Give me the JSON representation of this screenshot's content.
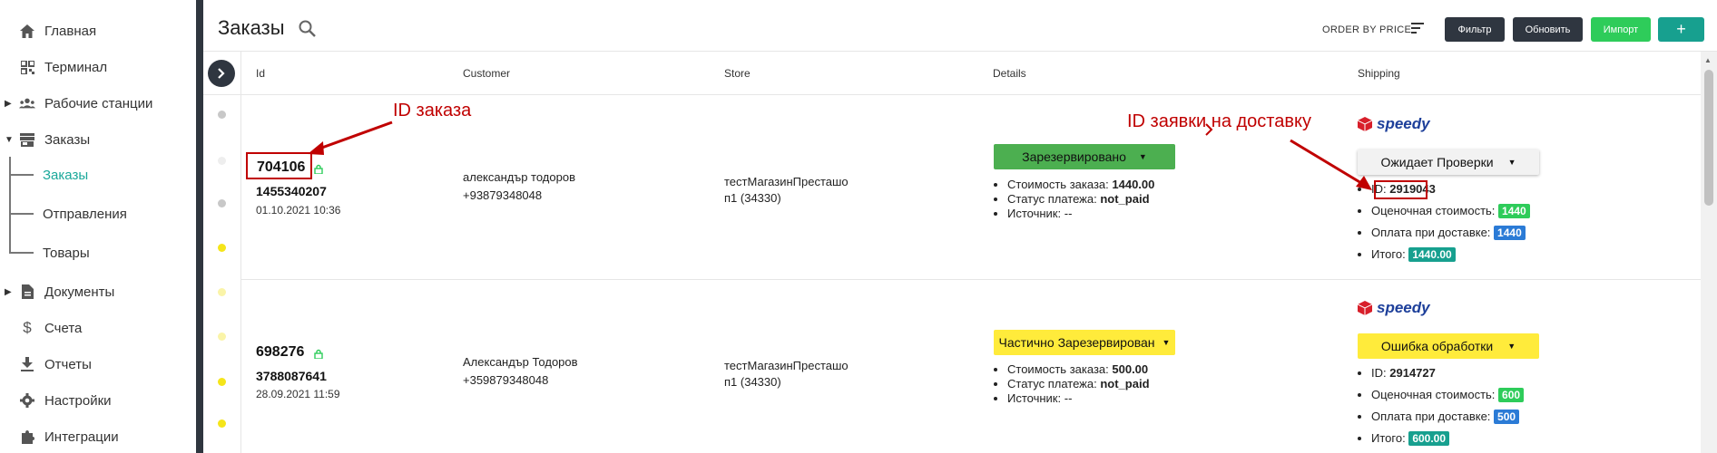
{
  "sidebar": {
    "items": [
      {
        "label": "Главная",
        "icon": "home-icon"
      },
      {
        "label": "Терминал",
        "icon": "grid-icon"
      },
      {
        "label": "Рабочие станции",
        "icon": "users-icon"
      },
      {
        "label": "Заказы",
        "icon": "store-icon"
      },
      {
        "label": "Документы",
        "icon": "document-icon"
      },
      {
        "label": "Счета",
        "icon": "dollar-icon"
      },
      {
        "label": "Отчеты",
        "icon": "download-icon"
      },
      {
        "label": "Настройки",
        "icon": "gear-icon"
      },
      {
        "label": "Интеграции",
        "icon": "puzzle-icon"
      }
    ],
    "sub_items": [
      "Заказы",
      "Отправления",
      "Товары"
    ]
  },
  "header": {
    "title": "Заказы",
    "order_by": "ORDER BY PRICE",
    "buttons": {
      "filter": "Фильтр",
      "refresh": "Обновить",
      "import": "Импорт",
      "add": "+"
    }
  },
  "columns": [
    "Id",
    "Customer",
    "Store",
    "Details",
    "Shipping"
  ],
  "orders": [
    {
      "id": "704106",
      "external_id": "1455340207",
      "date": "01.10.2021 10:36",
      "customer_name": "александър тодоров",
      "customer_phone": "+93879348048",
      "store_line1": "тестМагазинПресташо",
      "store_line2": "п1 (34330)",
      "status": "Зарезервировано",
      "status_color": "#4caf50",
      "details": {
        "cost_label": "Стоимость заказа:",
        "cost": "1440.00",
        "payment_label": "Статус платежа:",
        "payment": "not_paid",
        "source_label": "Источник:",
        "source": "--"
      },
      "carrier": "speedy",
      "shipping_status": "Ожидает Проверки",
      "shipping_status_color": "#f2f2f2",
      "shipping": {
        "id_label": "ID:",
        "id": "2919043",
        "est_label": "Оценочная стоимость:",
        "est": "1440",
        "cod_label": "Оплата при доставке:",
        "cod": "1440",
        "total_label": "Итого:",
        "total": "1440.00"
      }
    },
    {
      "id": "698276",
      "external_id": "3788087641",
      "date": "28.09.2021 11:59",
      "customer_name": "Александър Тодоров",
      "customer_phone": "+359879348048",
      "store_line1": "тестМагазинПресташо",
      "store_line2": "п1 (34330)",
      "status": "Частично Зарезервирован",
      "status_color": "#ffeb3b",
      "details": {
        "cost_label": "Стоимость заказа:",
        "cost": "500.00",
        "payment_label": "Статус платежа:",
        "payment": "not_paid",
        "source_label": "Источник:",
        "source": "--"
      },
      "carrier": "speedy",
      "shipping_status": "Ошибка обработки",
      "shipping_status_color": "#ffeb3b",
      "shipping": {
        "id_label": "ID:",
        "id": "2914727",
        "est_label": "Оценочная стоимость:",
        "est": "600",
        "cod_label": "Оплата при доставке:",
        "cod": "500",
        "total_label": "Итого:",
        "total": "600.00"
      }
    }
  ],
  "annotations": {
    "order_id": "ID заказа",
    "delivery_id": "ID заявки на доставку"
  },
  "colors": {
    "accent_teal": "#17a08f",
    "badge_green": "#2ecc5a",
    "badge_blue": "#2b7bd6",
    "badge_teal": "#17a08f",
    "annotation_red": "#c00000",
    "dark": "#2f3640"
  }
}
